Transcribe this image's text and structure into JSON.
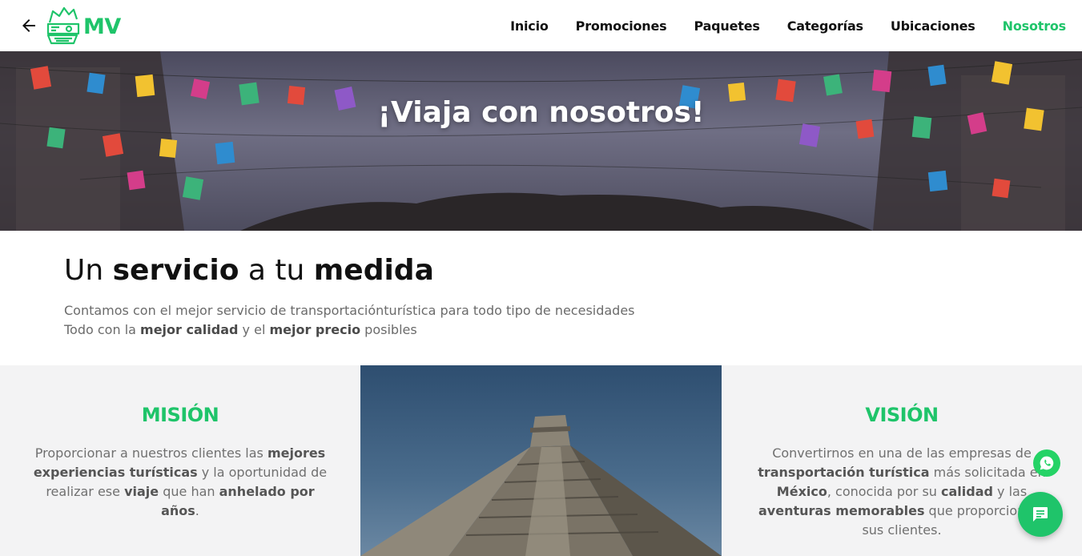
{
  "header": {
    "logo_text": "MV",
    "nav": [
      {
        "label": "Inicio"
      },
      {
        "label": "Promociones"
      },
      {
        "label": "Paquetes"
      },
      {
        "label": "Categorías"
      },
      {
        "label": "Ubicaciones"
      },
      {
        "label": "Nosotros",
        "active": true
      }
    ]
  },
  "hero": {
    "title": "¡Viaja con nosotros!"
  },
  "service": {
    "title_1": "Un ",
    "title_2": "servicio",
    "title_3": " a tu ",
    "title_4": "medida",
    "line1": "Contamos con el mejor servicio de transportaciónturística para todo tipo de necesidades",
    "line2_a": "Todo con la ",
    "line2_b": "mejor calidad",
    "line2_c": " y el ",
    "line2_d": "mejor precio",
    "line2_e": " posibles"
  },
  "mision": {
    "title": "MISIÓN",
    "t1": "Proporcionar a nuestros clientes las ",
    "t2": "mejores experiencias turísticas",
    "t3": " y la oportunidad de realizar ese ",
    "t4": "viaje",
    "t5": " que han ",
    "t6": "anhelado por años",
    "t7": "."
  },
  "vision": {
    "title": "VISIÓN",
    "t1": "Convertirnos en una de las empresas de ",
    "t2": "transportación turística",
    "t3": " más solicitada en ",
    "t4": "México",
    "t5": ", conocida por su ",
    "t6": "calidad",
    "t7": " y las ",
    "t8": "aventuras memorables",
    "t9": " que proporciona a sus clientes."
  },
  "colors": {
    "accent": "#1fc46a",
    "whatsapp": "#25d366",
    "section_bg": "#f3f3f4"
  },
  "icons": {
    "back": "arrow-left-icon",
    "logo": "aztec-head-logo",
    "whatsapp": "whatsapp-icon",
    "chat": "chat-bubble-icon"
  }
}
